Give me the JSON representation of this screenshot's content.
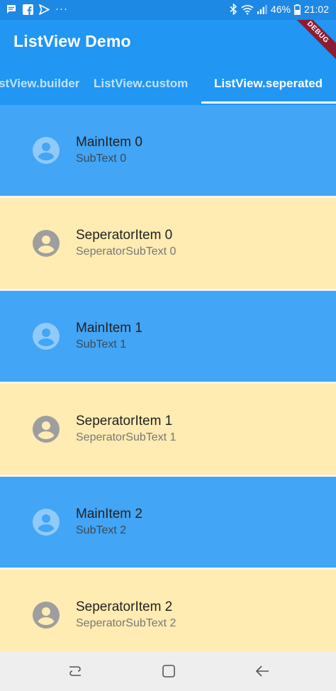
{
  "status_bar": {
    "battery_percent": "46%",
    "time": "21:02",
    "overflow": "···"
  },
  "app_bar": {
    "title": "ListView Demo",
    "debug_banner": "DEBUG",
    "tabs": [
      {
        "label": "ListView.builder",
        "active": false
      },
      {
        "label": "ListView.custom",
        "active": false
      },
      {
        "label": "ListView.seperated",
        "active": true
      }
    ]
  },
  "list": {
    "items": [
      {
        "title": "MainItem 0",
        "subtitle": "SubText 0",
        "kind": "main"
      },
      {
        "title": "SeperatorItem 0",
        "subtitle": "SeperatorSubText 0",
        "kind": "separator"
      },
      {
        "title": "MainItem 1",
        "subtitle": "SubText 1",
        "kind": "main"
      },
      {
        "title": "SeperatorItem 1",
        "subtitle": "SeperatorSubText 1",
        "kind": "separator"
      },
      {
        "title": "MainItem 2",
        "subtitle": "SubText 2",
        "kind": "main"
      },
      {
        "title": "SeperatorItem 2",
        "subtitle": "SeperatorSubText 2",
        "kind": "separator"
      }
    ]
  },
  "icons": {
    "status_left": [
      "message-icon",
      "facebook-icon",
      "send-icon"
    ],
    "status_right": [
      "bluetooth-icon",
      "wifi-icon",
      "signal-icon",
      "battery-icon"
    ],
    "list_avatar": "account-circle-icon",
    "nav": [
      "recents-icon",
      "home-icon",
      "back-icon"
    ]
  },
  "colors": {
    "status_bar": "#1e88e5",
    "app_bar": "#2196f3",
    "main_row": "#42a5f5",
    "separator_row": "#ffecb3",
    "main_avatar": "#90caf9",
    "separator_avatar": "#9e9e9e",
    "debug_banner": "#8b1d33"
  }
}
